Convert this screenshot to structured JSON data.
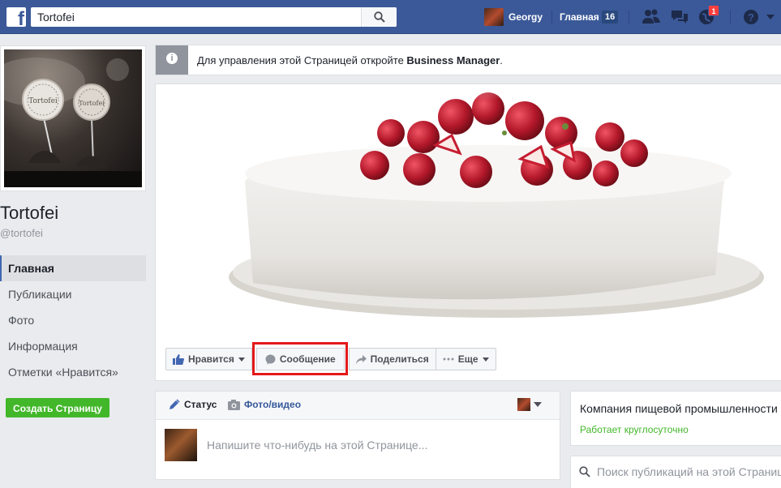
{
  "topbar": {
    "search_value": "Tortofei",
    "user_name": "Georgy",
    "home_label": "Главная",
    "home_count": "16",
    "notification_count": "1"
  },
  "page": {
    "name": "Tortofei",
    "handle": "@tortofei",
    "nav": [
      {
        "label": "Главная",
        "active": true
      },
      {
        "label": "Публикации"
      },
      {
        "label": "Фото"
      },
      {
        "label": "Информация"
      },
      {
        "label": "Отметки «Нравится»"
      }
    ],
    "create_page_label": "Создать Страницу"
  },
  "banner": {
    "text_prefix": "Для управления этой Страницей откройте ",
    "text_bold": "Business Manager",
    "text_suffix": "."
  },
  "actions": {
    "like_label": "Нравится",
    "message_label": "Сообщение",
    "share_label": "Поделиться",
    "more_label": "Еще"
  },
  "composer": {
    "status_tab": "Статус",
    "photo_tab": "Фото/видео",
    "placeholder": "Напишите что-нибудь на этой Странице..."
  },
  "sidebar_right": {
    "company_category": "Компания пищевой промышленности",
    "hours_status": "Работает круглосуточно",
    "search_placeholder": "Поиск публикаций на этой Странице"
  },
  "colors": {
    "brand_blue": "#3b5998",
    "green": "#42b72a",
    "highlight_red": "#e4191b"
  }
}
